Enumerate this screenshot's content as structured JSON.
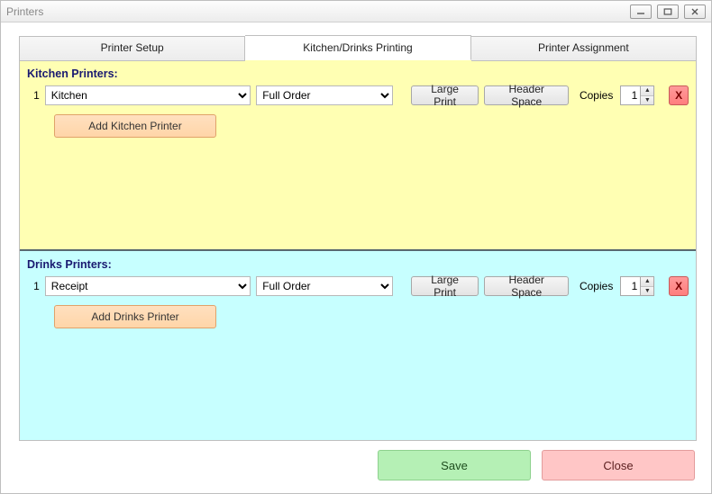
{
  "window": {
    "title": "Printers"
  },
  "tabs": {
    "setup": "Printer Setup",
    "kd": "Kitchen/Drinks Printing",
    "assign": "Printer Assignment"
  },
  "kitchen": {
    "title": "Kitchen Printers:",
    "row": {
      "index": "1",
      "printer": "Kitchen",
      "mode": "Full Order",
      "large_print": "Large Print",
      "header_space": "Header Space",
      "copies_label": "Copies",
      "copies": "1",
      "delete": "X"
    },
    "add": "Add Kitchen Printer"
  },
  "drinks": {
    "title": "Drinks Printers:",
    "row": {
      "index": "1",
      "printer": "Receipt",
      "mode": "Full Order",
      "large_print": "Large Print",
      "header_space": "Header Space",
      "copies_label": "Copies",
      "copies": "1",
      "delete": "X"
    },
    "add": "Add Drinks Printer"
  },
  "footer": {
    "save": "Save",
    "close": "Close"
  }
}
